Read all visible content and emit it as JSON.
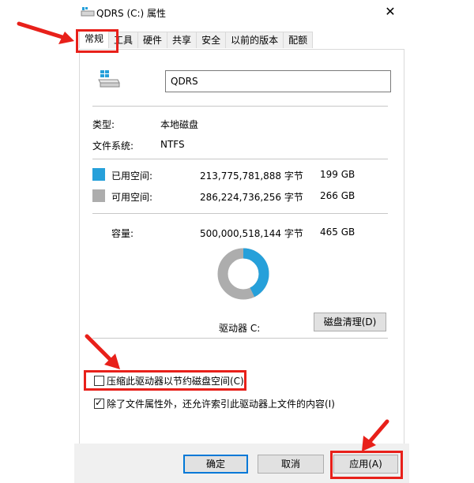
{
  "window": {
    "title": "QDRS (C:) 属性",
    "close_symbol": "✕"
  },
  "tabs": [
    {
      "label": "常规"
    },
    {
      "label": "工具"
    },
    {
      "label": "硬件"
    },
    {
      "label": "共享"
    },
    {
      "label": "安全"
    },
    {
      "label": "以前的版本"
    },
    {
      "label": "配额"
    }
  ],
  "drive": {
    "name_value": "QDRS",
    "type_label": "类型:",
    "type_value": "本地磁盘",
    "fs_label": "文件系统:",
    "fs_value": "NTFS"
  },
  "space": {
    "used": {
      "label": "已用空间:",
      "bytes": "213,775,781,888 字节",
      "size": "199 GB",
      "color": "#26a0da"
    },
    "free": {
      "label": "可用空间:",
      "bytes": "286,224,736,256 字节",
      "size": "266 GB",
      "color": "#adadad"
    },
    "capacity": {
      "label": "容量:",
      "bytes": "500,000,518,144 字节",
      "size": "465 GB"
    },
    "used_fraction": 0.4276
  },
  "drive_label": "驱动器 C:",
  "cleanup_button": "磁盘清理(D)",
  "options": {
    "compress": {
      "label": "压缩此驱动器以节约磁盘空间(C)",
      "checked": false
    },
    "index": {
      "label": "除了文件属性外，还允许索引此驱动器上文件的内容(I)",
      "checked": true
    }
  },
  "buttons": {
    "ok": "确定",
    "cancel": "取消",
    "apply": "应用(A)"
  },
  "colors": {
    "annotation_red": "#e8201a",
    "accent": "#0078d7"
  }
}
